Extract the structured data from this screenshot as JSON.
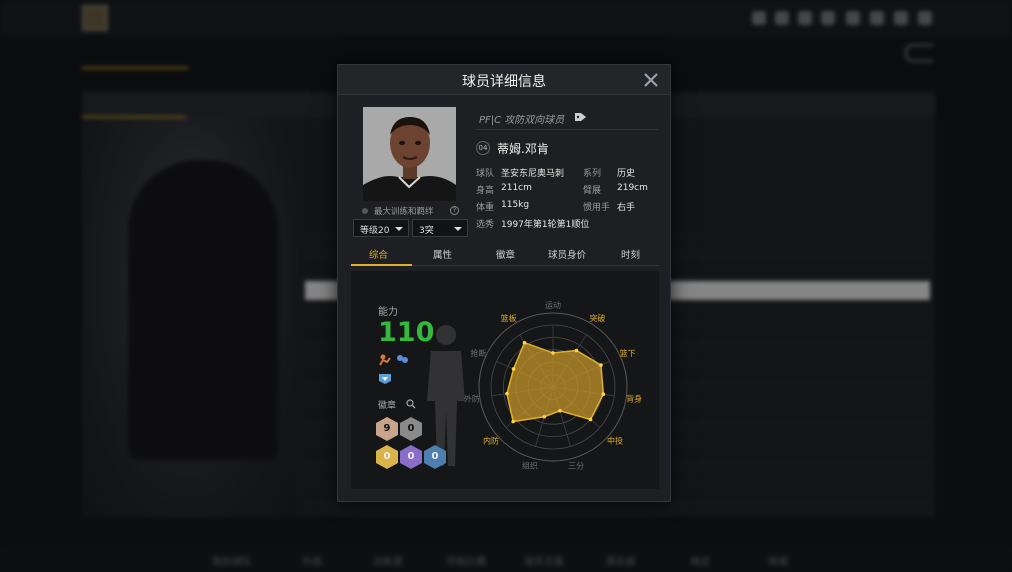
{
  "modal": {
    "title": "球员详细信息",
    "position_line": "PF|C 攻防双向球员",
    "jersey_number": "04",
    "player_name": "蒂姆.邓肯",
    "trainer_label": "最大训练和羁绊",
    "level_select": "等级20",
    "break_select": "3突",
    "info": [
      {
        "key": "球队",
        "value": "圣安东尼奥马刺"
      },
      {
        "key": "系列",
        "value": "历史"
      },
      {
        "key": "身高",
        "value": "211cm"
      },
      {
        "key": "臂展",
        "value": "219cm"
      },
      {
        "key": "体重",
        "value": "115kg"
      },
      {
        "key": "惯用手",
        "value": "右手"
      },
      {
        "key": "选秀",
        "value": "1997年第1轮第1顺位"
      }
    ],
    "tabs": [
      "综合",
      "属性",
      "徽章",
      "球员身价",
      "时刻"
    ],
    "active_tab": "综合",
    "ability_label": "能力",
    "ability_value": "110",
    "badge_label": "徽章",
    "badges": [
      {
        "count": "9",
        "color": "#c8a48c"
      },
      {
        "count": "0",
        "color": "#8a8a8a"
      },
      {
        "count": "0",
        "color": "#d9b44a"
      },
      {
        "count": "0",
        "color": "#8a6cc9"
      },
      {
        "count": "0",
        "color": "#4f7fb0"
      }
    ],
    "radar": {
      "axes": [
        "运动",
        "突破",
        "篮下",
        "背身",
        "中投",
        "三分",
        "组织",
        "内防",
        "外防",
        "抢断",
        "篮板"
      ],
      "highlighted_axes": [
        "突破",
        "篮下",
        "背身",
        "中投",
        "内防",
        "篮板"
      ],
      "values": [
        0.55,
        0.7,
        0.85,
        0.82,
        0.8,
        0.4,
        0.5,
        0.85,
        0.75,
        0.7,
        0.85
      ]
    },
    "colors": {
      "gold": "#e0b02c",
      "ability_green": "#34b93d"
    }
  },
  "background": {
    "bottom_nav": [
      "我的球队",
      "升级",
      "训练营",
      "开始比赛",
      "球员交易",
      "俱乐部",
      "商店",
      "商城"
    ]
  }
}
